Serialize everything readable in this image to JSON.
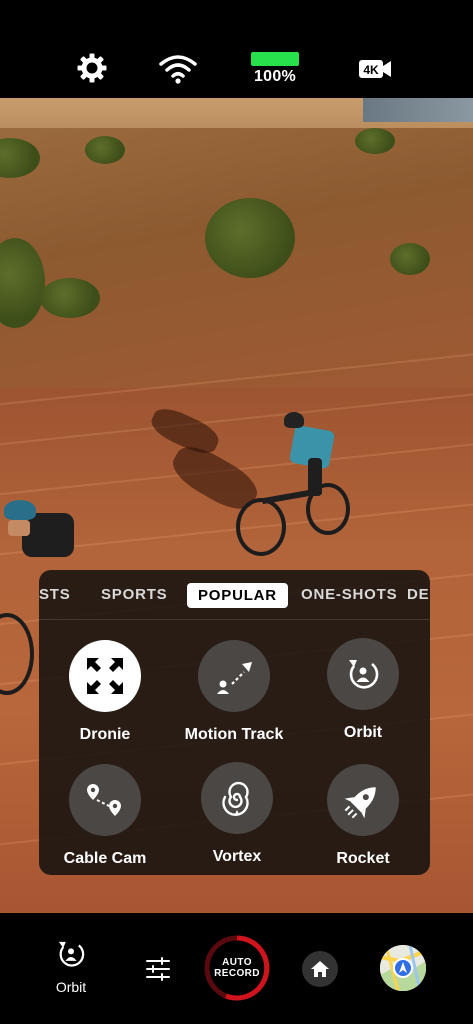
{
  "status_bar": {
    "icons": [
      "gear-icon",
      "wifi-icon",
      "battery-icon",
      "4k-resolution-icon"
    ],
    "battery_percent_text": "100%",
    "battery_level": 1.0,
    "battery_color": "#27e04c"
  },
  "mode_panel": {
    "tabs": [
      {
        "label": "STS"
      },
      {
        "label": "SPORTS"
      },
      {
        "label": "POPULAR",
        "active": true
      },
      {
        "label": "ONE-SHOTS"
      },
      {
        "label": "DE"
      }
    ],
    "modes": [
      {
        "label": "Dronie",
        "icon": "expand-arrows-icon",
        "selected": true
      },
      {
        "label": "Motion Track",
        "icon": "motion-track-icon"
      },
      {
        "label": "Orbit",
        "icon": "orbit-icon"
      },
      {
        "label": "Cable Cam",
        "icon": "cable-cam-icon"
      },
      {
        "label": "Vortex",
        "icon": "vortex-spiral-icon"
      },
      {
        "label": "Rocket",
        "icon": "rocket-icon"
      }
    ]
  },
  "bottom_bar": {
    "current_mode_label": "Orbit",
    "record_label_line1": "AUTO",
    "record_label_line2": "RECORD",
    "record_ring_color": "#d0141e",
    "icons": [
      "orbit-icon",
      "sliders-icon",
      "record-button",
      "home-icon",
      "map-icon"
    ]
  }
}
